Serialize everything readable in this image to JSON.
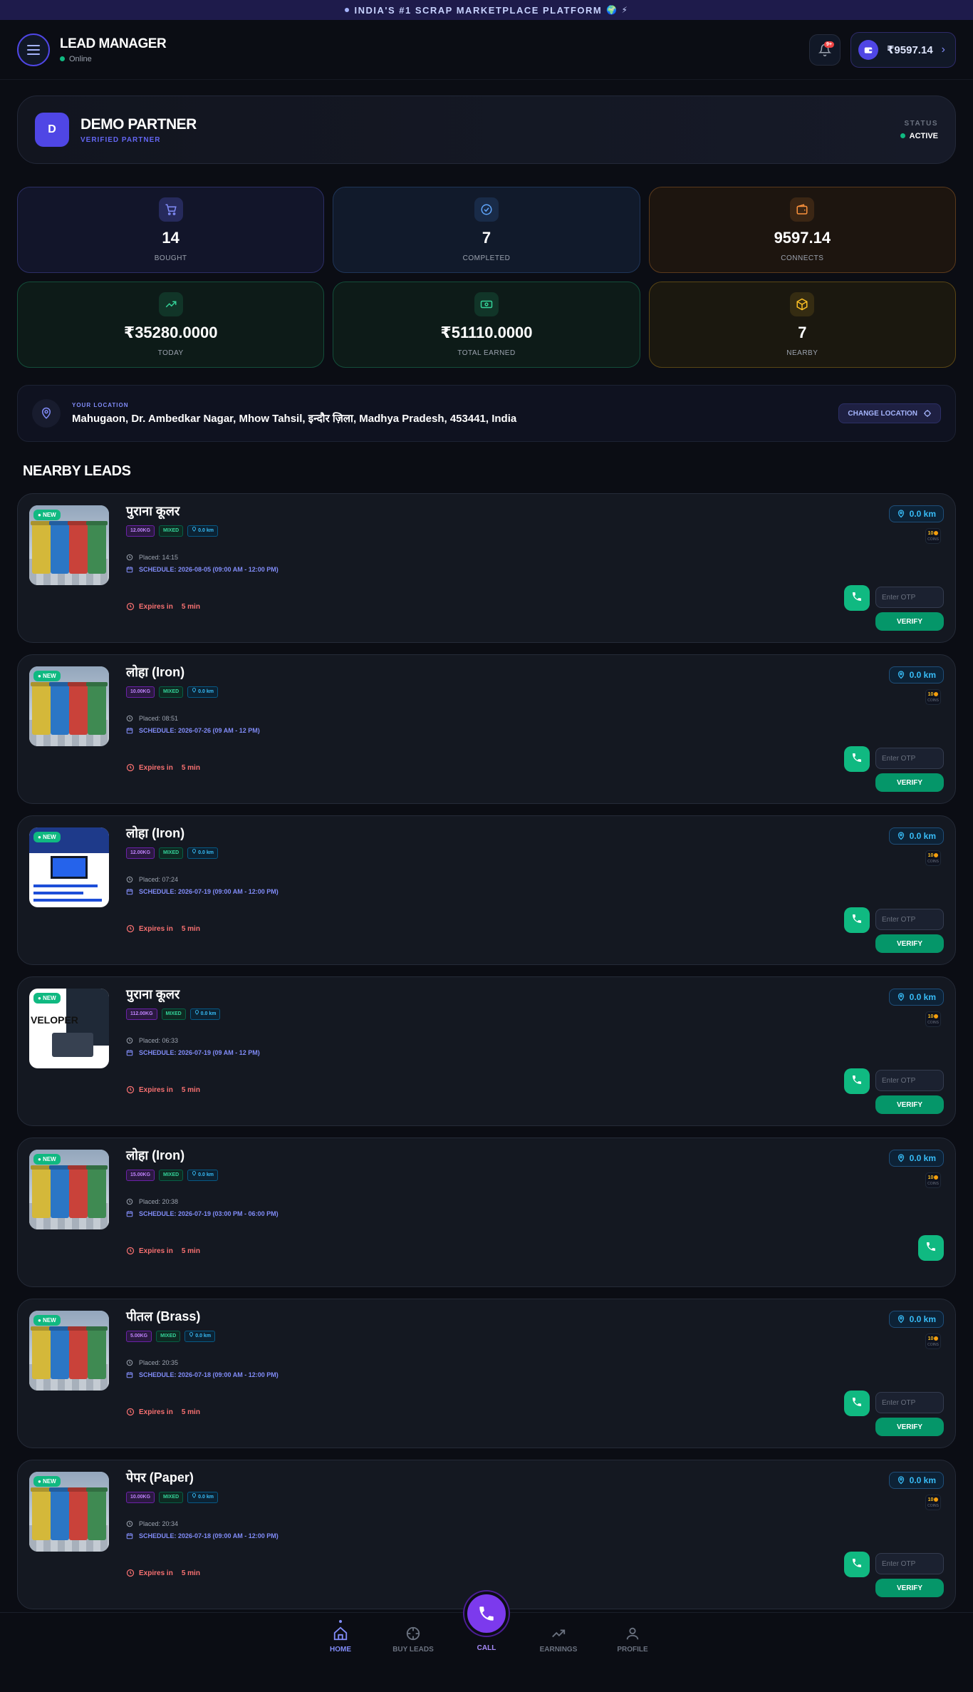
{
  "banner": {
    "text": "INDIA'S #1 SCRAP MARKETPLACE PLATFORM",
    "emoji": "🌍 ⚡"
  },
  "header": {
    "title": "LEAD MANAGER",
    "status": "Online",
    "notif_badge": "9+",
    "wallet_amount": "₹9597.14"
  },
  "partner": {
    "avatar": "D",
    "name": "DEMO PARTNER",
    "subtitle": "VERIFIED PARTNER",
    "status_label": "STATUS",
    "status_value": "ACTIVE"
  },
  "stats": [
    {
      "value": "14",
      "label": "BOUGHT",
      "icon": "cart-icon",
      "color": "#818cf8"
    },
    {
      "value": "7",
      "label": "COMPLETED",
      "icon": "check-circle-icon",
      "color": "#60a5fa"
    },
    {
      "value": "9597.14",
      "label": "CONNECTS",
      "icon": "wallet-icon",
      "color": "#fb923c"
    },
    {
      "value": "₹35280.0000",
      "label": "TODAY",
      "icon": "trending-up-icon",
      "color": "#34d399"
    },
    {
      "value": "₹51110.0000",
      "label": "TOTAL EARNED",
      "icon": "banknote-icon",
      "color": "#34d399"
    },
    {
      "value": "7",
      "label": "NEARBY",
      "icon": "box-icon",
      "color": "#fbbf24"
    }
  ],
  "location": {
    "label": "YOUR LOCATION",
    "address": "Mahugaon, Dr. Ambedkar Nagar, Mhow Tahsil, इन्दौर ज़िला, Madhya Pradesh, 453441, India",
    "button": "CHANGE LOCATION"
  },
  "section_title": "NEARBY LEADS",
  "leads": [
    {
      "title": "पुराना कूलर",
      "weight": "12.00KG",
      "type": "MIXED",
      "distance": "0.0 km",
      "placed": "Placed: 14:15",
      "schedule": "SCHEDULE: 2026-08-05 (09:00 AM - 12:00 PM)",
      "expires_label": "Expires in",
      "expires_value": "5 min",
      "badge": "NEW",
      "cost": "10",
      "cost_unit": "COINS",
      "image": "bins"
    },
    {
      "title": "लोहा (Iron)",
      "weight": "10.00KG",
      "type": "MIXED",
      "distance": "0.0 km",
      "placed": "Placed: 08:51",
      "schedule": "SCHEDULE: 2026-07-26 (09 AM - 12 PM)",
      "expires_label": "Expires in",
      "expires_value": "5 min",
      "badge": "NEW",
      "cost": "10",
      "cost_unit": "COINS",
      "image": "bins"
    },
    {
      "title": "लोहा (Iron)",
      "weight": "12.00KG",
      "type": "MIXED",
      "distance": "0.0 km",
      "placed": "Placed: 07:24",
      "schedule": "SCHEDULE: 2026-07-19 (09:00 AM - 12:00 PM)",
      "expires_label": "Expires in",
      "expires_value": "5 min",
      "badge": "NEW",
      "cost": "10",
      "cost_unit": "COINS",
      "image": "flyer"
    },
    {
      "title": "पुराना कूलर",
      "weight": "112.00KG",
      "type": "MIXED",
      "distance": "0.0 km",
      "placed": "Placed: 06:33",
      "schedule": "SCHEDULE: 2026-07-19 (09 AM - 12 PM)",
      "expires_label": "Expires in",
      "expires_value": "5 min",
      "badge": "NEW",
      "cost": "10",
      "cost_unit": "COINS",
      "image": "flyer2"
    },
    {
      "title": "लोहा (Iron)",
      "weight": "15.00KG",
      "type": "MIXED",
      "distance": "0.0 km",
      "placed": "Placed: 20:38",
      "schedule": "SCHEDULE: 2026-07-19 (03:00 PM - 06:00 PM)",
      "expires_label": "Expires in",
      "expires_value": "5 min",
      "badge": "NEW",
      "cost": "10",
      "cost_unit": "COINS",
      "image": "bins"
    },
    {
      "title": "पीतल (Brass)",
      "weight": "5.00KG",
      "type": "MIXED",
      "distance": "0.0 km",
      "placed": "Placed: 20:35",
      "schedule": "SCHEDULE: 2026-07-18 (09:00 AM - 12:00 PM)",
      "expires_label": "Expires in",
      "expires_value": "5 min",
      "badge": "NEW",
      "cost": "10",
      "cost_unit": "COINS",
      "image": "bins"
    },
    {
      "title": "पेपर (Paper)",
      "weight": "10.00KG",
      "type": "MIXED",
      "distance": "0.0 km",
      "placed": "Placed: 20:34",
      "schedule": "SCHEDULE: 2026-07-18 (09:00 AM - 12:00 PM)",
      "expires_label": "Expires in",
      "expires_value": "5 min",
      "badge": "NEW",
      "cost": "10",
      "cost_unit": "COINS",
      "image": "bins"
    }
  ],
  "lead_actions": {
    "otp_placeholder": "Enter OTP",
    "verify": "VERIFY"
  },
  "nav": {
    "home": "HOME",
    "buy_leads": "BUY LEADS",
    "call": "CALL",
    "earnings": "EARNINGS",
    "profile": "PROFILE"
  }
}
